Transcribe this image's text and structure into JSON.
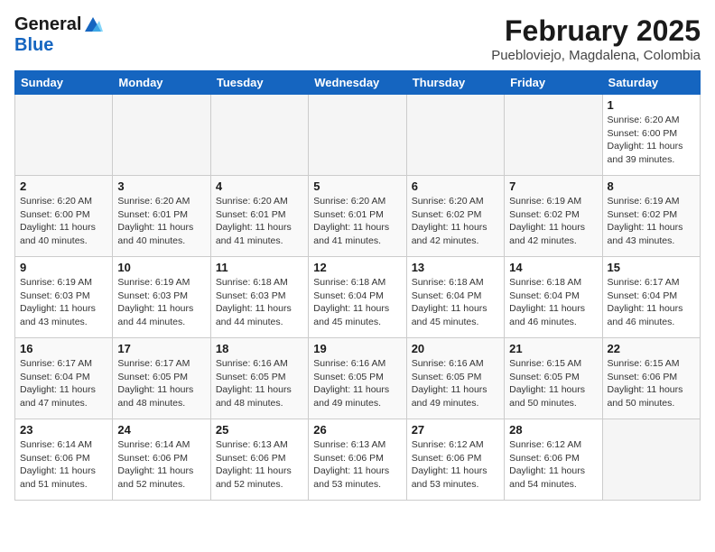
{
  "header": {
    "logo_line1": "General",
    "logo_line2": "Blue",
    "month_year": "February 2025",
    "location": "Puebloviejo, Magdalena, Colombia"
  },
  "days_of_week": [
    "Sunday",
    "Monday",
    "Tuesday",
    "Wednesday",
    "Thursday",
    "Friday",
    "Saturday"
  ],
  "weeks": [
    [
      {
        "day": null
      },
      {
        "day": null
      },
      {
        "day": null
      },
      {
        "day": null
      },
      {
        "day": null
      },
      {
        "day": null
      },
      {
        "day": 1,
        "sunrise": "6:20 AM",
        "sunset": "6:00 PM",
        "daylight": "11 hours and 39 minutes."
      }
    ],
    [
      {
        "day": 2,
        "sunrise": "6:20 AM",
        "sunset": "6:00 PM",
        "daylight": "11 hours and 40 minutes."
      },
      {
        "day": 3,
        "sunrise": "6:20 AM",
        "sunset": "6:01 PM",
        "daylight": "11 hours and 40 minutes."
      },
      {
        "day": 4,
        "sunrise": "6:20 AM",
        "sunset": "6:01 PM",
        "daylight": "11 hours and 41 minutes."
      },
      {
        "day": 5,
        "sunrise": "6:20 AM",
        "sunset": "6:01 PM",
        "daylight": "11 hours and 41 minutes."
      },
      {
        "day": 6,
        "sunrise": "6:20 AM",
        "sunset": "6:02 PM",
        "daylight": "11 hours and 42 minutes."
      },
      {
        "day": 7,
        "sunrise": "6:19 AM",
        "sunset": "6:02 PM",
        "daylight": "11 hours and 42 minutes."
      },
      {
        "day": 8,
        "sunrise": "6:19 AM",
        "sunset": "6:02 PM",
        "daylight": "11 hours and 43 minutes."
      }
    ],
    [
      {
        "day": 9,
        "sunrise": "6:19 AM",
        "sunset": "6:03 PM",
        "daylight": "11 hours and 43 minutes."
      },
      {
        "day": 10,
        "sunrise": "6:19 AM",
        "sunset": "6:03 PM",
        "daylight": "11 hours and 44 minutes."
      },
      {
        "day": 11,
        "sunrise": "6:18 AM",
        "sunset": "6:03 PM",
        "daylight": "11 hours and 44 minutes."
      },
      {
        "day": 12,
        "sunrise": "6:18 AM",
        "sunset": "6:04 PM",
        "daylight": "11 hours and 45 minutes."
      },
      {
        "day": 13,
        "sunrise": "6:18 AM",
        "sunset": "6:04 PM",
        "daylight": "11 hours and 45 minutes."
      },
      {
        "day": 14,
        "sunrise": "6:18 AM",
        "sunset": "6:04 PM",
        "daylight": "11 hours and 46 minutes."
      },
      {
        "day": 15,
        "sunrise": "6:17 AM",
        "sunset": "6:04 PM",
        "daylight": "11 hours and 46 minutes."
      }
    ],
    [
      {
        "day": 16,
        "sunrise": "6:17 AM",
        "sunset": "6:04 PM",
        "daylight": "11 hours and 47 minutes."
      },
      {
        "day": 17,
        "sunrise": "6:17 AM",
        "sunset": "6:05 PM",
        "daylight": "11 hours and 48 minutes."
      },
      {
        "day": 18,
        "sunrise": "6:16 AM",
        "sunset": "6:05 PM",
        "daylight": "11 hours and 48 minutes."
      },
      {
        "day": 19,
        "sunrise": "6:16 AM",
        "sunset": "6:05 PM",
        "daylight": "11 hours and 49 minutes."
      },
      {
        "day": 20,
        "sunrise": "6:16 AM",
        "sunset": "6:05 PM",
        "daylight": "11 hours and 49 minutes."
      },
      {
        "day": 21,
        "sunrise": "6:15 AM",
        "sunset": "6:05 PM",
        "daylight": "11 hours and 50 minutes."
      },
      {
        "day": 22,
        "sunrise": "6:15 AM",
        "sunset": "6:06 PM",
        "daylight": "11 hours and 50 minutes."
      }
    ],
    [
      {
        "day": 23,
        "sunrise": "6:14 AM",
        "sunset": "6:06 PM",
        "daylight": "11 hours and 51 minutes."
      },
      {
        "day": 24,
        "sunrise": "6:14 AM",
        "sunset": "6:06 PM",
        "daylight": "11 hours and 52 minutes."
      },
      {
        "day": 25,
        "sunrise": "6:13 AM",
        "sunset": "6:06 PM",
        "daylight": "11 hours and 52 minutes."
      },
      {
        "day": 26,
        "sunrise": "6:13 AM",
        "sunset": "6:06 PM",
        "daylight": "11 hours and 53 minutes."
      },
      {
        "day": 27,
        "sunrise": "6:12 AM",
        "sunset": "6:06 PM",
        "daylight": "11 hours and 53 minutes."
      },
      {
        "day": 28,
        "sunrise": "6:12 AM",
        "sunset": "6:06 PM",
        "daylight": "11 hours and 54 minutes."
      },
      {
        "day": null
      }
    ]
  ],
  "labels": {
    "sunrise": "Sunrise:",
    "sunset": "Sunset:",
    "daylight": "Daylight:"
  }
}
